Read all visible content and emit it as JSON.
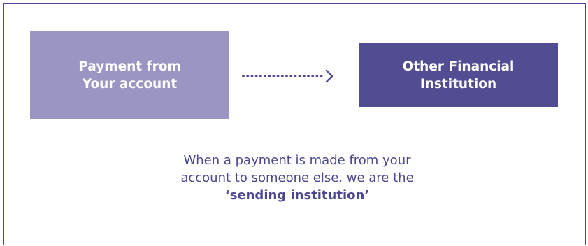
{
  "diagram": {
    "source_box": {
      "line1": "Payment from",
      "line2": "Your account"
    },
    "target_box": {
      "line1": "Other Financial",
      "line2": "Institution"
    },
    "caption": {
      "line1": "When a payment is made from your",
      "line2": "account to someone else, we are the",
      "line3": "‘sending institution’"
    }
  },
  "colors": {
    "border": "#4b4791",
    "source_fill": "#9a95c3",
    "target_fill": "#524c92",
    "text_accent": "#4b4791",
    "box_text": "#ffffff"
  }
}
